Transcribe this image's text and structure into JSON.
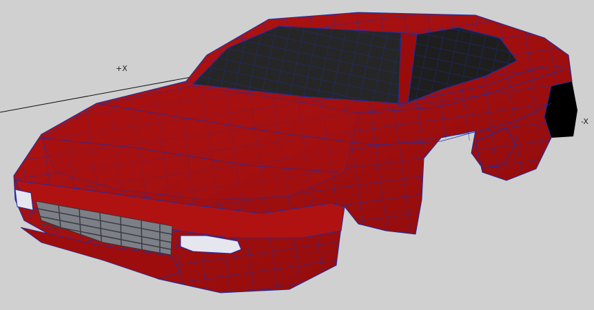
{
  "viewport": {
    "axis_labels": {
      "positive_x": "+X",
      "negative_x": "-X"
    },
    "colors": {
      "background": "#d0d0d0",
      "body_paint": "#a30d0d",
      "body_shadow": "#7a0808",
      "wireframe": "#1b2ea8",
      "glass": "#262626",
      "wheel_well": "#000000",
      "grille": "#7d7f86",
      "headlight": "#e6e6ee"
    },
    "model": {
      "name_icon": "car-wireframe-model"
    }
  }
}
